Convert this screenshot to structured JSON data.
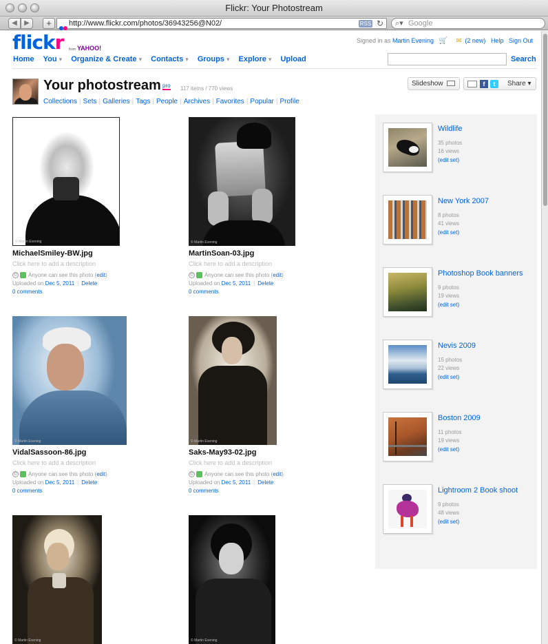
{
  "window": {
    "title": "Flickr: Your Photostream",
    "url": "http://www.flickr.com/photos/36943256@N02/",
    "rss_label": "RSS",
    "search_placeholder": "Google"
  },
  "header": {
    "logo_fl": "flick",
    "logo_kr": "r",
    "logo_from": "from",
    "logo_yahoo": "YAHOO!",
    "signed_in_prefix": "Signed in as",
    "user_name": "Martin Evening",
    "new_mail": "(2 new)",
    "help": "Help",
    "sign_out": "Sign Out",
    "nav": [
      {
        "label": "Home",
        "caret": false
      },
      {
        "label": "You",
        "caret": true
      },
      {
        "label": "Organize & Create",
        "caret": true
      },
      {
        "label": "Contacts",
        "caret": true
      },
      {
        "label": "Groups",
        "caret": true
      },
      {
        "label": "Explore",
        "caret": true
      },
      {
        "label": "Upload",
        "caret": false
      }
    ],
    "search_button": "Search"
  },
  "photostream": {
    "title": "Your photostream",
    "pro": "pro",
    "counts": "117 items / 770 views",
    "subnav": [
      "Collections",
      "Sets",
      "Galleries",
      "Tags",
      "People",
      "Archives",
      "Favorites",
      "Popular",
      "Profile"
    ],
    "slideshow": "Slideshow",
    "share": "Share ▾"
  },
  "photo_common": {
    "desc_placeholder": "Click here to add a description",
    "visibility": "Anyone can see this photo",
    "edit": "edit",
    "uploaded_prefix": "Uploaded on",
    "upload_date": "Dec 5, 2011",
    "delete": "Delete",
    "comments": "0 comments"
  },
  "photos": [
    {
      "name": "MichaelSmiley-BW.jpg"
    },
    {
      "name": "MartinSoan-03.jpg"
    },
    {
      "name": "VidalSassoon-86.jpg"
    },
    {
      "name": "Saks-May93-02.jpg"
    },
    {
      "name": ""
    },
    {
      "name": ""
    }
  ],
  "sets": [
    {
      "title": "Wildlife",
      "photos": "35 photos",
      "views": "16 views",
      "edit": "(edit set)"
    },
    {
      "title": "New York 2007",
      "photos": "8 photos",
      "views": "41 views",
      "edit": "(edit set)"
    },
    {
      "title": "Photoshop Book banners",
      "photos": "9 photos",
      "views": "19 views",
      "edit": "(edit set)"
    },
    {
      "title": "Nevis 2009",
      "photos": "15 photos",
      "views": "22 views",
      "edit": "(edit set)"
    },
    {
      "title": "Boston 2009",
      "photos": "11 photos",
      "views": "19 views",
      "edit": "(edit set)"
    },
    {
      "title": "Lightroom 2 Book shoot",
      "photos": "9 photos",
      "views": "48 views",
      "edit": "(edit set)"
    }
  ],
  "colors": {
    "flickr_blue": "#0063dc",
    "flickr_pink": "#ff0084",
    "sidebar_bg": "#f3f3f3"
  }
}
